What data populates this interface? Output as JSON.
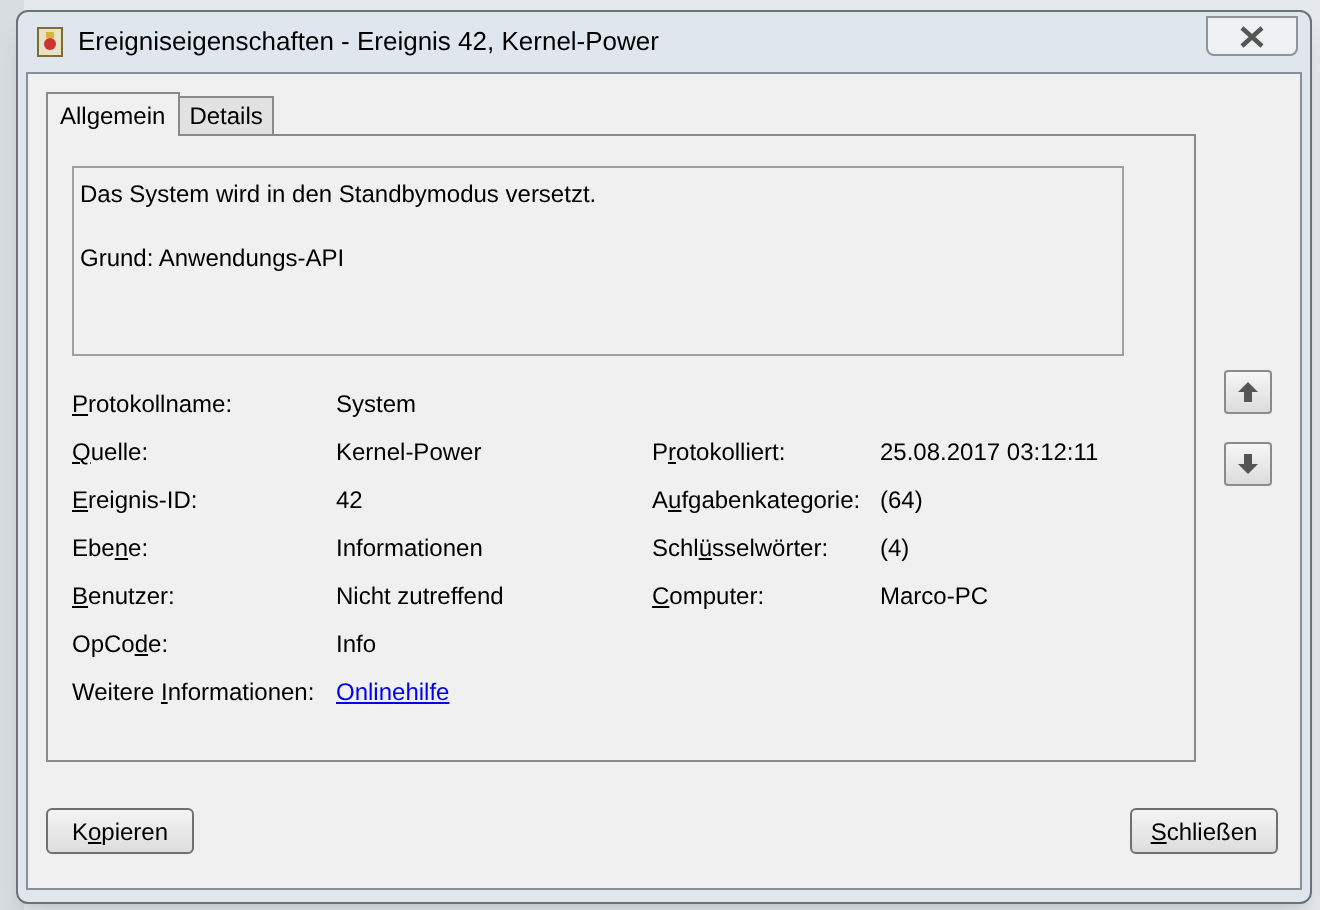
{
  "window": {
    "title": "Ereigniseigenschaften - Ereignis 42, Kernel-Power"
  },
  "tabs": [
    {
      "label": "Allgemein",
      "selected": true
    },
    {
      "label": "Details",
      "selected": false
    }
  ],
  "message": [
    "Das System wird in den Standbymodus versetzt.",
    "Grund: Anwendungs-API"
  ],
  "fields_left": [
    {
      "label": [
        {
          "text": "P",
          "underlined": true
        },
        {
          "text": "rotokollname:",
          "underlined": false
        }
      ],
      "value": "System",
      "kind": "text"
    },
    {
      "label": [
        {
          "text": "Q",
          "underlined": true
        },
        {
          "text": "uelle:",
          "underlined": false
        }
      ],
      "value": "Kernel-Power",
      "kind": "text"
    },
    {
      "label": [
        {
          "text": "E",
          "underlined": true
        },
        {
          "text": "reignis-ID:",
          "underlined": false
        }
      ],
      "value": "42",
      "kind": "text"
    },
    {
      "label": [
        {
          "text": "Ebe",
          "underlined": false
        },
        {
          "text": "n",
          "underlined": true
        },
        {
          "text": "e:",
          "underlined": false
        }
      ],
      "value": "Informationen",
      "kind": "text"
    },
    {
      "label": [
        {
          "text": "B",
          "underlined": true
        },
        {
          "text": "enutzer:",
          "underlined": false
        }
      ],
      "value": "Nicht zutreffend",
      "kind": "text"
    },
    {
      "label": [
        {
          "text": "OpCo",
          "underlined": false
        },
        {
          "text": "d",
          "underlined": true
        },
        {
          "text": "e:",
          "underlined": false
        }
      ],
      "value": "Info",
      "kind": "text"
    },
    {
      "label": [
        {
          "text": "Weitere ",
          "underlined": false
        },
        {
          "text": "I",
          "underlined": true
        },
        {
          "text": "nformationen:",
          "underlined": false
        }
      ],
      "value": "Onlinehilfe",
      "kind": "link"
    }
  ],
  "fields_right": [
    {
      "label": [
        {
          "text": "P",
          "underlined": false
        },
        {
          "text": "r",
          "underlined": true
        },
        {
          "text": "otokolliert:",
          "underlined": false
        }
      ],
      "value": "25.08.2017 03:12:11"
    },
    {
      "label": [
        {
          "text": "A",
          "underlined": false
        },
        {
          "text": "u",
          "underlined": true
        },
        {
          "text": "fgabenkategorie:",
          "underlined": false
        }
      ],
      "value": "(64)"
    },
    {
      "label": [
        {
          "text": "Schl",
          "underlined": false
        },
        {
          "text": "ü",
          "underlined": true
        },
        {
          "text": "sselwörter:",
          "underlined": false
        }
      ],
      "value": "(4)"
    },
    {
      "label": [
        {
          "text": "C",
          "underlined": true
        },
        {
          "text": "omputer:",
          "underlined": false
        }
      ],
      "value": "Marco-PC"
    }
  ],
  "buttons": [
    {
      "label": [
        {
          "text": "K",
          "underlined": false
        },
        {
          "text": "o",
          "underlined": true
        },
        {
          "text": "pieren",
          "underlined": false
        }
      ]
    },
    {
      "label": [
        {
          "text": "S",
          "underlined": true
        },
        {
          "text": "chließen",
          "underlined": false
        }
      ]
    }
  ]
}
